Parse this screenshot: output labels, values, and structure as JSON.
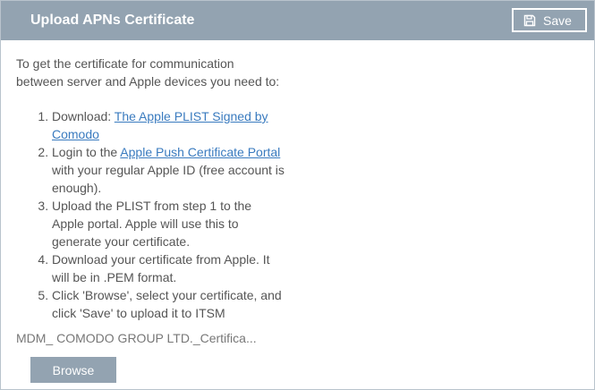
{
  "dialog": {
    "title": "Upload APNs Certificate",
    "save_label": "Save",
    "save_icon": "floppy-disk-icon"
  },
  "instructions": {
    "intro": "To get the certificate for communication between server and Apple devices you need to:",
    "step1_prefix": "Download: ",
    "step1_link": "The Apple PLIST Signed by Comodo",
    "step2_prefix": "Login to the ",
    "step2_link": "Apple Push Certificate Portal",
    "step2_suffix": " with your regular Apple ID (free account is enough).",
    "step3": "Upload the PLIST from step 1 to the Apple portal. Apple will use this to generate your certificate.",
    "step4": "Download your certificate from Apple. It will be in .PEM format.",
    "step5": "Click 'Browse', select your certificate, and click 'Save' to upload it to ITSM"
  },
  "file": {
    "name": "MDM_ COMODO GROUP LTD._Certifica..."
  },
  "browse": {
    "label": "Browse"
  },
  "colors": {
    "header_bg": "#93a3b1",
    "link": "#3a7bbf",
    "text": "#555555"
  }
}
